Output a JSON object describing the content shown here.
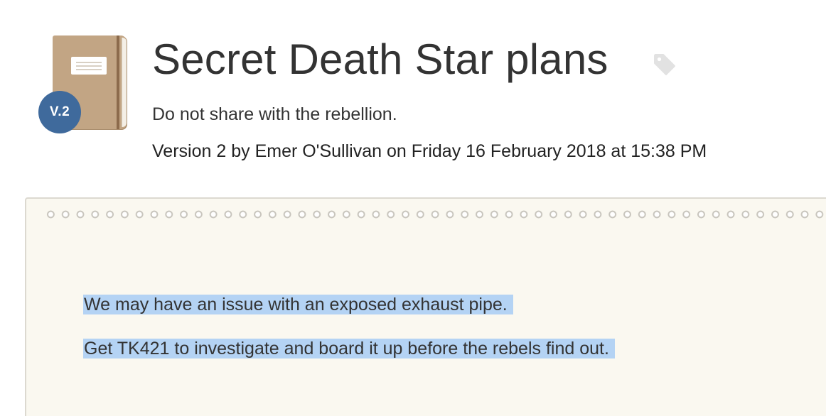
{
  "note": {
    "title": "Secret Death Star plans",
    "description": "Do not share with the rebellion.",
    "version_badge": "V.2",
    "meta": {
      "version": "Version 2",
      "by_word": "by",
      "author": "Emer O'Sullivan",
      "on_word": "on",
      "date": "Friday 16 February 2018 at 15:38 PM"
    },
    "icons": {
      "notebook": "notebook-icon",
      "tag": "tag-icon"
    },
    "body_lines": [
      "We may have an issue with an exposed exhaust pipe.",
      "Get TK421 to investigate and board it up before the rebels find out."
    ],
    "selection_color": "#b4d3f4",
    "badge_color": "#3f6a9c",
    "paper_color": "#faf8f0"
  }
}
